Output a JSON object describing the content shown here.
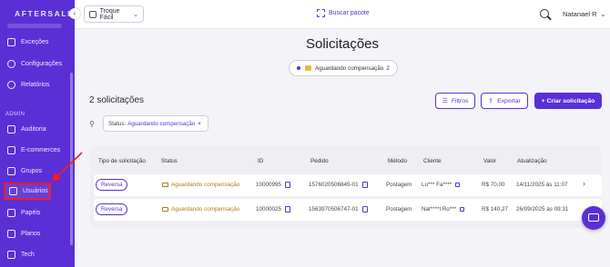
{
  "app": {
    "logo": "AFTERSALE"
  },
  "sidebar": {
    "top_items": [
      {
        "label": "Exceções",
        "icon": "alert-icon"
      },
      {
        "label": "Configurações",
        "icon": "gear-icon"
      },
      {
        "label": "Relatórios",
        "icon": "report-icon"
      }
    ],
    "admin_label": "ADMIN",
    "admin_items": [
      {
        "label": "Auditoria",
        "icon": "audit-icon"
      },
      {
        "label": "E-commerces",
        "icon": "store-icon"
      },
      {
        "label": "Grupos",
        "icon": "groups-icon"
      },
      {
        "label": "Usuários",
        "icon": "users-icon",
        "active": true
      },
      {
        "label": "Papéis",
        "icon": "roles-icon"
      },
      {
        "label": "Planos",
        "icon": "plans-icon"
      },
      {
        "label": "Tech",
        "icon": "tech-icon"
      }
    ]
  },
  "topbar": {
    "store": "Troque Fácil",
    "scan_label": "Buscar pacote",
    "user_name": "Natanael R"
  },
  "main": {
    "title": "Solicitações",
    "status_pill": {
      "label": "Aguardando compensação",
      "count": "2"
    },
    "count_title": "2 solicitações",
    "buttons": {
      "filters": "Filtros",
      "export": "Exportar",
      "create": "+ Criar solicitação"
    },
    "filter_chip": {
      "key": "Status:",
      "value": "Aguardando compensação"
    }
  },
  "table": {
    "headers": [
      "Tipo de solicitação",
      "Status",
      "ID",
      "Pedido",
      "Método",
      "Cliente",
      "Valor",
      "Atualização"
    ],
    "rows": [
      {
        "type": "Reversa",
        "status": "Aguardando compensação",
        "id": "10000995",
        "order": "1576020506845-01",
        "method": "Postagem",
        "client": "Lu*** Fa****",
        "value": "R$ 70,00",
        "updated": "14/11/2025 às 11:07"
      },
      {
        "type": "Reversa",
        "status": "Aguardando compensação",
        "id": "10000025",
        "order": "1563970506747-01",
        "method": "Postagem",
        "client": "Nat****l Ro***",
        "value": "R$ 140,27",
        "updated": "26/09/2025 às 09:31"
      }
    ]
  },
  "colors": {
    "brand": "#5a2fd6",
    "highlight": "#ff1a1a",
    "status": "#b07d10"
  }
}
